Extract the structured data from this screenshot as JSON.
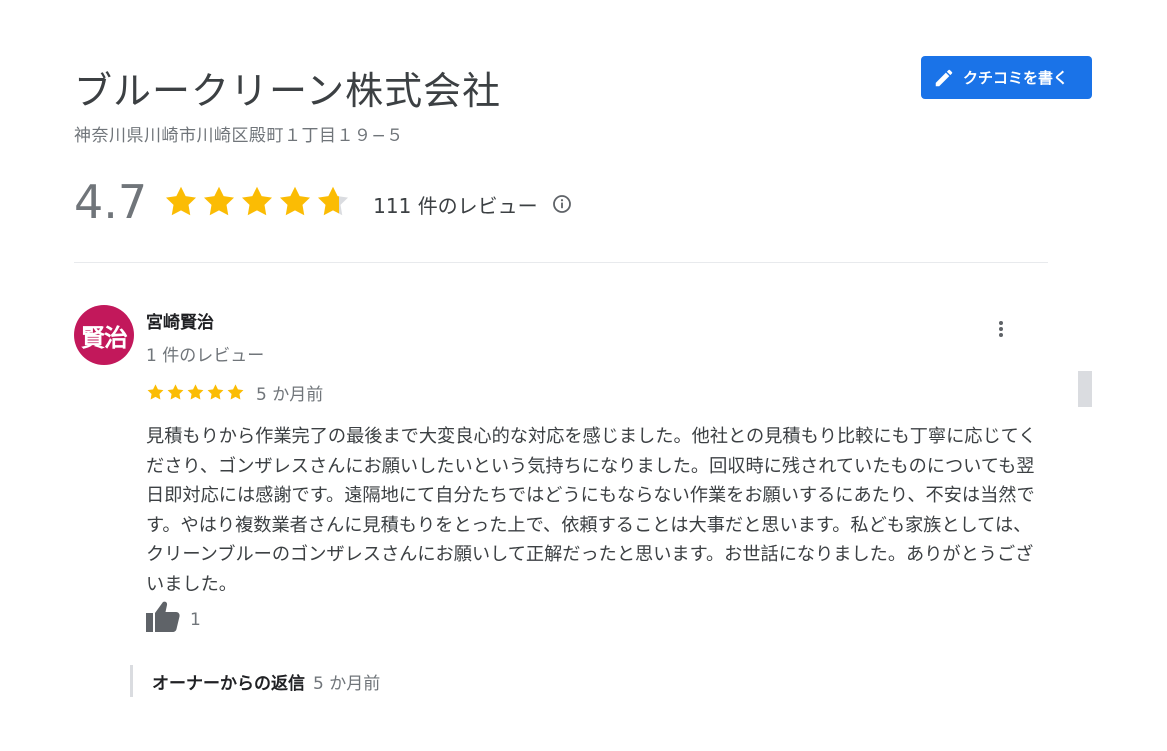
{
  "business": {
    "name": "ブルークリーン株式会社",
    "address": "神奈川県川崎市川崎区殿町１丁目１９−５",
    "rating": "4.7",
    "rating_value": 4.7,
    "review_count": "111 件のレビュー",
    "write_review_label": "クチコミを書く"
  },
  "review": {
    "avatar_text": "賢治",
    "avatar_color": "#c2185b",
    "author": "宮崎賢治",
    "author_meta": "1 件のレビュー",
    "stars": 5,
    "date": "5 か月前",
    "text": "見積もりから作業完了の最後まで大変良心的な対応を感じました。他社との見積もり比較にも丁寧に応じてくださり、ゴンザレスさんにお願いしたいという気持ちになりました。回収時に残されていたものについても翌日即対応には感謝です。遠隔地にて自分たちではどうにもならない作業をお願いするにあたり、不安は当然です。やはり複数業者さんに見積もりをとった上で、依頼することは大事だと思います。私ども家族としては、クリーンブルーのゴンザレスさんにお願いして正解だったと思います。お世話になりました。ありがとうございました。",
    "likes": "1"
  },
  "owner_reply": {
    "label": "オーナーからの返信",
    "date": "5 か月前"
  },
  "colors": {
    "accent": "#1a73e8",
    "star": "#fbbc04",
    "star_empty": "#dadce0"
  },
  "icons": {
    "write": "pencil-icon",
    "info": "info-icon",
    "more": "more-vert-icon",
    "like": "thumbs-up-icon"
  }
}
